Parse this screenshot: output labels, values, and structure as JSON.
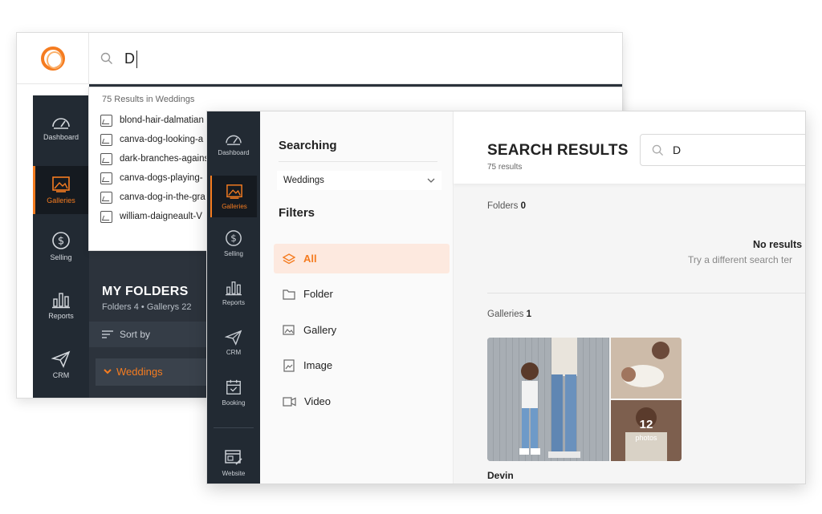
{
  "back_window": {
    "search_query": "D",
    "dropdown": {
      "header": "75 Results in Weddings",
      "items": [
        "blond-hair-dalmatian",
        "canva-dog-looking-a",
        "dark-branches-agains",
        "canva-dogs-playing-",
        "canva-dog-in-the-gra",
        "william-daigneault-V"
      ]
    },
    "sidebar": [
      {
        "label": "Dashboard",
        "icon": "dashboard-icon"
      },
      {
        "label": "Galleries",
        "icon": "galleries-icon",
        "active": true
      },
      {
        "label": "Selling",
        "icon": "dollar-icon"
      },
      {
        "label": "Reports",
        "icon": "bar-chart-icon"
      },
      {
        "label": "CRM",
        "icon": "paper-plane-icon"
      }
    ],
    "my_folders": {
      "title": "MY FOLDERS",
      "subtitle": "Folders 4  •  Gallerys 22",
      "sort_by": "Sort by",
      "weddings": "Weddings"
    }
  },
  "front_window": {
    "sidebar": [
      {
        "label": "Dashboard",
        "icon": "dashboard-icon"
      },
      {
        "label": "Galleries",
        "icon": "galleries-icon",
        "active": true
      },
      {
        "label": "Selling",
        "icon": "dollar-icon"
      },
      {
        "label": "Reports",
        "icon": "bar-chart-icon"
      },
      {
        "label": "CRM",
        "icon": "paper-plane-icon"
      },
      {
        "label": "Booking",
        "icon": "calendar-icon"
      },
      {
        "label": "Website",
        "icon": "website-icon"
      }
    ],
    "filter_panel": {
      "searching_label": "Searching",
      "scope": "Weddings",
      "filters_label": "Filters",
      "filters": [
        {
          "label": "All",
          "icon": "layers-icon",
          "active": true
        },
        {
          "label": "Folder",
          "icon": "folder-icon"
        },
        {
          "label": "Gallery",
          "icon": "gallery-icon"
        },
        {
          "label": "Image",
          "icon": "image-icon"
        },
        {
          "label": "Video",
          "icon": "video-icon"
        }
      ]
    },
    "results": {
      "title": "SEARCH RESULTS",
      "count": "75 results",
      "search_query": "D",
      "folders_label": "Folders",
      "folders_count": "0",
      "no_results_title": "No results",
      "no_results_sub": "Try a different search ter",
      "galleries_label": "Galleries",
      "galleries_count": "1",
      "gallery": {
        "name": "Devin",
        "photo_count": "12",
        "photo_label": "photos"
      }
    }
  },
  "colors": {
    "accent": "#f57c20",
    "sidebar_bg": "#222a33",
    "active_filter_bg": "#fde9df"
  }
}
